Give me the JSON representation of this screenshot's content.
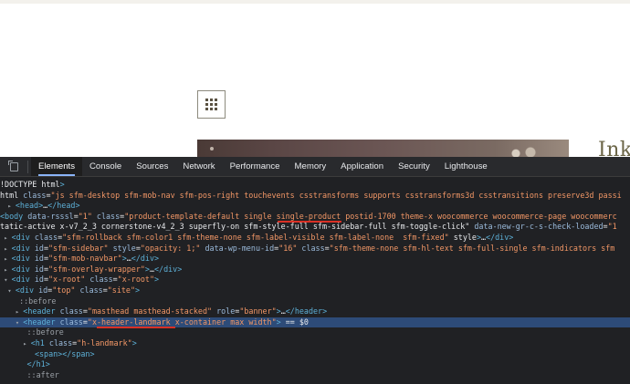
{
  "page": {
    "side_heading": "Ink",
    "grid_button_icon": "grid-icon"
  },
  "devtools": {
    "inspect_icon": "inspect-element-icon",
    "tabs": [
      "Elements",
      "Console",
      "Sources",
      "Network",
      "Performance",
      "Memory",
      "Application",
      "Security",
      "Lighthouse"
    ],
    "active_tab": "Elements",
    "lines": [
      {
        "text": "!DOCTYPE html>"
      },
      {
        "text": "html class=\"js sfm-desktop sfm-mob-nav sfm-pos-right touchevents csstransforms supports csstransforms3d csstransitions preserve3d passi"
      },
      {
        "text": "<head>…</head>"
      },
      {
        "text": "<body data-rsssl=\"1\" class=\"product-template-default single single-product postid-1700 theme-x woocommerce woocommerce-page woocommerc"
      },
      {
        "text": "tatic-active x-v7_2_3 cornerstone-v4_2_3 superfly-on sfm-style-full sfm-sidebar-full sfm-toggle-click\" data-new-gr-c-s-check-loaded=\"1"
      },
      {
        "text": "<div class=\"sfm-rollback sfm-color1 sfm-theme-none sfm-label-visible sfm-label-none  sfm-fixed\" style>…</div>"
      },
      {
        "text": "<div id=\"sfm-sidebar\" style=\"opacity: 1;\" data-wp-menu-id=\"16\" class=\"sfm-theme-none sfm-hl-text sfm-full-single sfm-indicators sfm"
      },
      {
        "text": "<div id=\"sfm-mob-navbar\">…</div>"
      },
      {
        "text": "<div id=\"sfm-overlay-wrapper\">…</div>"
      },
      {
        "text": "<div id=\"x-root\" class=\"x-root\">"
      },
      {
        "text": "<div id=\"top\" class=\"site\">"
      },
      {
        "text": "::before"
      },
      {
        "text": "<header class=\"masthead masthead-stacked\" role=\"banner\">…</header>"
      },
      {
        "text": "<header class=\"x-header-landmark x-container max width\"> == $0"
      },
      {
        "text": "::before"
      },
      {
        "text": "<h1 class=\"h-landmark\">"
      },
      {
        "text": "<span></span>"
      },
      {
        "text": "</h1>"
      },
      {
        "text": "::after"
      }
    ]
  },
  "colors": {
    "devtools_bg": "#202124",
    "tabbar_bg": "#292a2d",
    "selected_row": "#2d4b78",
    "tag": "#5db0d7",
    "attr_name": "#9bbbdc",
    "attr_value": "#f29766",
    "annotation_underline": "#d93025"
  }
}
